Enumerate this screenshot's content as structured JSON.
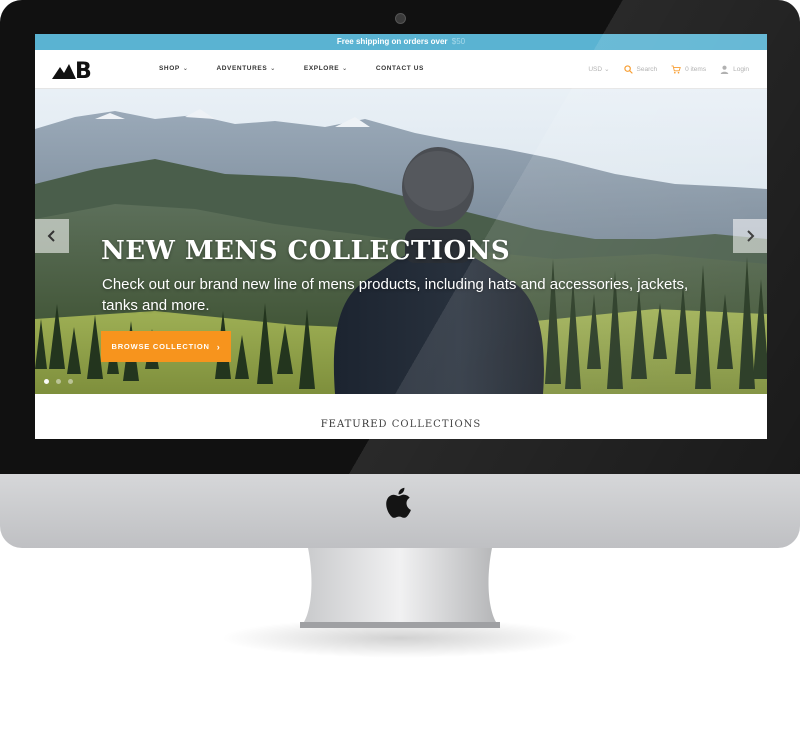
{
  "announcement": {
    "text": "Free shipping on orders over",
    "amount": "$50"
  },
  "brand": {
    "logo_text": "B"
  },
  "nav": {
    "items": [
      {
        "label": "SHOP",
        "has_dropdown": true
      },
      {
        "label": "ADVENTURES",
        "has_dropdown": true
      },
      {
        "label": "EXPLORE",
        "has_dropdown": true
      },
      {
        "label": "CONTACT US",
        "has_dropdown": false
      }
    ]
  },
  "tools": {
    "currency": "USD",
    "search_label": "Search",
    "cart_label": "0 items",
    "login_label": "Login"
  },
  "hero": {
    "title": "NEW MENS COLLECTIONS",
    "subtitle": "Check out our brand new line of mens products, including hats and accessories, jackets, tanks and more.",
    "cta_label": "BROWSE COLLECTION",
    "dots_count": 3,
    "active_dot": 1
  },
  "featured": {
    "heading": "FEATURED COLLECTIONS"
  },
  "colors": {
    "announcement_bg": "#5ab3d2",
    "cta_bg": "#f7941d",
    "accent_icons": "#f7941d"
  },
  "icons": {
    "search": "search-icon",
    "cart": "cart-icon",
    "user": "user-icon",
    "prev": "chevron-left-icon",
    "next": "chevron-right-icon",
    "apple": "apple-logo-icon"
  }
}
